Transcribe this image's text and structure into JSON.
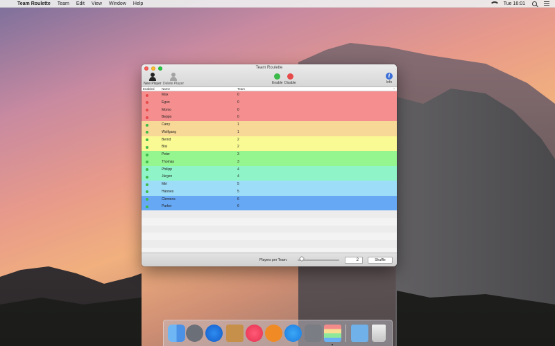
{
  "menubar": {
    "apple": "",
    "app_name": "Team Roulette",
    "menus": [
      "Team",
      "Edit",
      "View",
      "Window",
      "Help"
    ],
    "clock": "Tue 16:01"
  },
  "window": {
    "title": "Team Roulette",
    "toolbar": {
      "new_player": "New Player",
      "delete_player": "Delete Player",
      "enable": "Enable",
      "disable": "Disable",
      "info": "Info",
      "info_glyph": "i"
    },
    "columns": {
      "enabled": "Enabled",
      "name": "Name",
      "team": "Team"
    },
    "sort_indicator": "^",
    "players": [
      {
        "name": "Max",
        "team": "0",
        "enabled_color": "#e64a4a",
        "row_color": "#f58f8f"
      },
      {
        "name": "Egon",
        "team": "0",
        "enabled_color": "#e64a4a",
        "row_color": "#f58f8f"
      },
      {
        "name": "Momo",
        "team": "0",
        "enabled_color": "#e64a4a",
        "row_color": "#f58f8f"
      },
      {
        "name": "Beppo",
        "team": "0",
        "enabled_color": "#e64a4a",
        "row_color": "#f58f8f"
      },
      {
        "name": "Carry",
        "team": "1",
        "enabled_color": "#3dbb4a",
        "row_color": "#f8d896"
      },
      {
        "name": "Wolfgang",
        "team": "1",
        "enabled_color": "#3dbb4a",
        "row_color": "#f8d896"
      },
      {
        "name": "Bernd",
        "team": "2",
        "enabled_color": "#3dbb4a",
        "row_color": "#fafa94"
      },
      {
        "name": "Bisi",
        "team": "2",
        "enabled_color": "#3dbb4a",
        "row_color": "#fafa94"
      },
      {
        "name": "Peter",
        "team": "3",
        "enabled_color": "#3dbb4a",
        "row_color": "#95f58f"
      },
      {
        "name": "Thomas",
        "team": "3",
        "enabled_color": "#3dbb4a",
        "row_color": "#95f58f"
      },
      {
        "name": "Philipp",
        "team": "4",
        "enabled_color": "#3dbb4a",
        "row_color": "#8ff5c8"
      },
      {
        "name": "Jürgen",
        "team": "4",
        "enabled_color": "#3dbb4a",
        "row_color": "#8ff5c8"
      },
      {
        "name": "Miri",
        "team": "5",
        "enabled_color": "#3dbb4a",
        "row_color": "#9dddf7"
      },
      {
        "name": "Hannes",
        "team": "5",
        "enabled_color": "#3dbb4a",
        "row_color": "#9dddf7"
      },
      {
        "name": "Clemens",
        "team": "6",
        "enabled_color": "#3dbb4a",
        "row_color": "#67a8f5"
      },
      {
        "name": "Parker",
        "team": "6",
        "enabled_color": "#3dbb4a",
        "row_color": "#67a8f5"
      }
    ],
    "bottom": {
      "players_per_team_label": "Players per Team:",
      "players_per_team_value": "2",
      "shuffle": "Shuffle"
    }
  },
  "colors": {
    "enable": "#3dbb4a",
    "disable": "#e64a4a",
    "active_person": "#222222",
    "inactive_person": "#9a9a9a"
  },
  "dock": {
    "icons": [
      "finder-icon",
      "launchpad-icon",
      "safari-icon",
      "notes-icon",
      "itunes-icon",
      "ibooks-icon",
      "appstore-icon",
      "prefs-icon",
      "teamroulette-icon",
      "folder-icon",
      "trash-icon"
    ]
  }
}
